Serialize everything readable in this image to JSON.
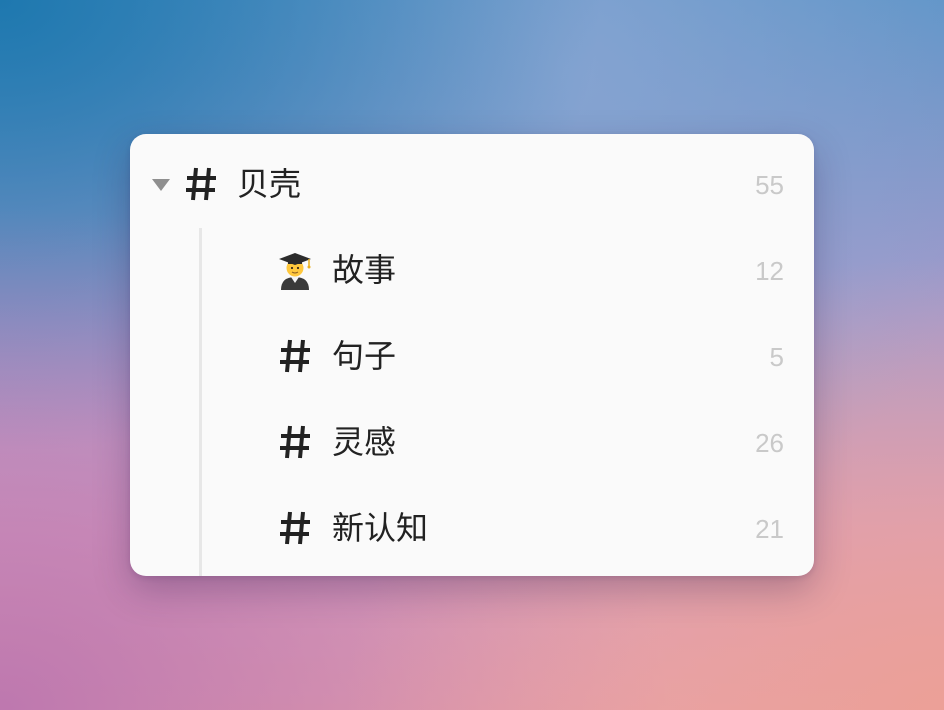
{
  "tree": {
    "parent": {
      "icon": "hash-icon",
      "label": "贝壳",
      "count": "55",
      "expanded": true
    },
    "children": [
      {
        "icon": "student-emoji-icon",
        "label": "故事",
        "count": "12"
      },
      {
        "icon": "hash-icon",
        "label": "句子",
        "count": "5"
      },
      {
        "icon": "hash-icon",
        "label": "灵感",
        "count": "26"
      },
      {
        "icon": "hash-icon",
        "label": "新认知",
        "count": "21"
      }
    ]
  },
  "colors": {
    "panel_background": "#fafafa",
    "text": "#222222",
    "count_text": "#c9c9c9",
    "caret": "#8f8f8f",
    "guide_line": "#e7e7e7"
  }
}
